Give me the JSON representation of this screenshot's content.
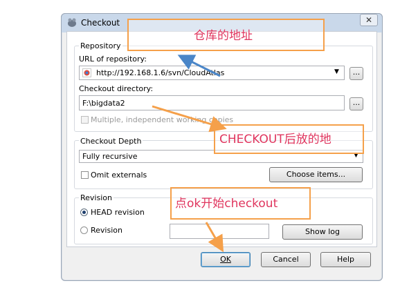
{
  "window": {
    "title": "Checkout",
    "close_label": "✕"
  },
  "repository": {
    "group_label": "Repository",
    "url_label": "URL of repository:",
    "url_value": "http://192.168.1.6/svn/CloudAtlas",
    "browse_label": "...",
    "dir_label": "Checkout directory:",
    "dir_value": "F:\\bigdata2",
    "dir_browse_label": "...",
    "multiple_label": "Multiple, independent working copies"
  },
  "depth": {
    "group_label": "Checkout Depth",
    "selected": "Fully recursive",
    "omit_label": "Omit externals",
    "choose_label": "Choose items..."
  },
  "revision": {
    "group_label": "Revision",
    "head_label": "HEAD revision",
    "rev_label": "Revision",
    "rev_value": "",
    "showlog_label": "Show log"
  },
  "buttons": {
    "ok": "OK",
    "cancel": "Cancel",
    "help": "Help"
  },
  "annotations": {
    "repo_address": "仓库的地址",
    "checkout_location": "CHECKOUT后放的地",
    "click_ok": "点ok开始checkout"
  },
  "colors": {
    "annotation_box": "#f5a04a",
    "annotation_text": "#e0355e",
    "arrow": "#4a86c8"
  }
}
